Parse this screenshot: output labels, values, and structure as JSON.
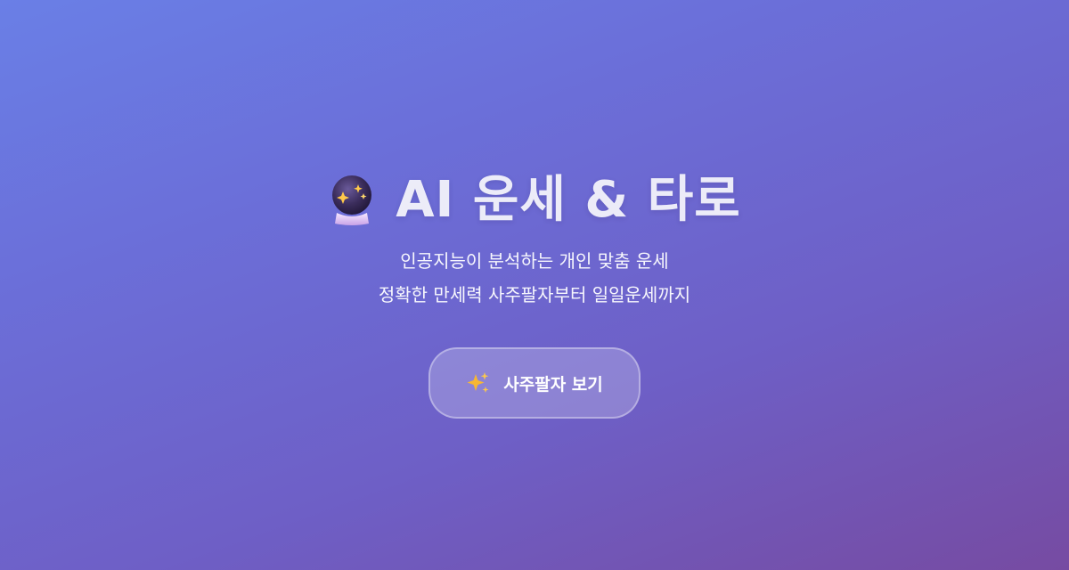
{
  "hero": {
    "title": "AI 운세 & 타로",
    "title_icon": "crystal-ball-icon",
    "subtitle_line1": "인공지능이 분석하는 개인 맞춤 운세",
    "subtitle_line2": "정확한 만세력 사주팔자부터 일일운세까지",
    "cta": {
      "label": "사주팔자 보기",
      "icon": "sparkles-icon"
    }
  },
  "colors": {
    "gradient_start": "#6a7fe6",
    "gradient_end": "#764ba2",
    "sparkle": "#f7b733"
  }
}
